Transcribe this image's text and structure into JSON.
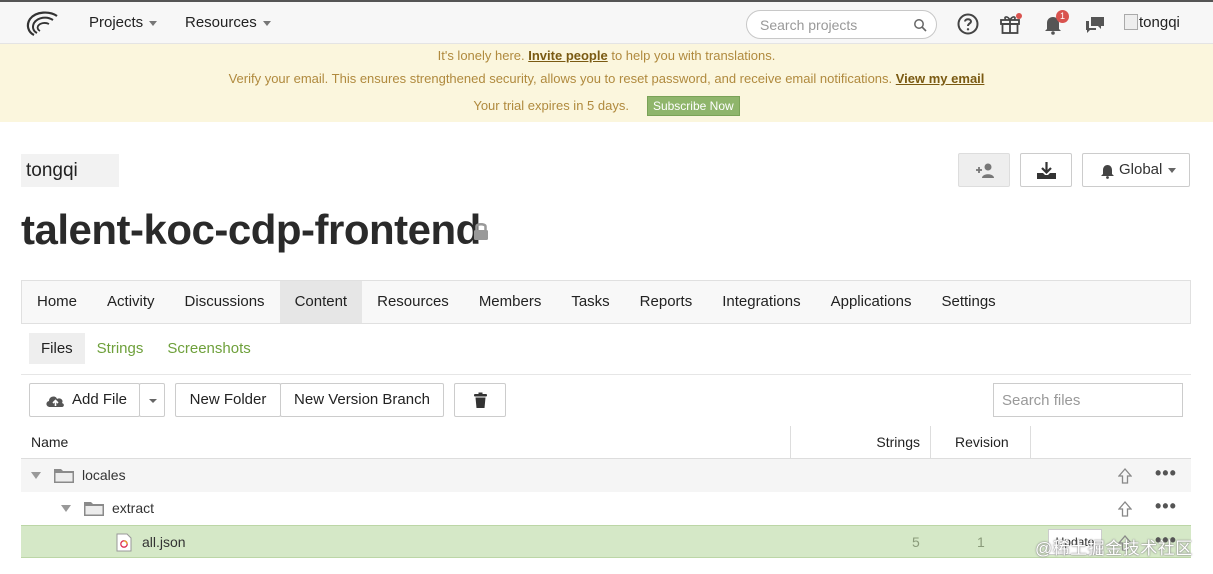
{
  "topbar": {
    "projects_label": "Projects",
    "resources_label": "Resources",
    "search_placeholder": "Search projects",
    "notification_count": "1",
    "user_alt": "tongqi"
  },
  "banner": {
    "line1_before": "It's lonely here. ",
    "line1_link": "Invite people",
    "line1_after": " to help you with translations.",
    "line2_before": "Verify your email. This ensures strengthened security, allows you to reset password, and receive email notifications. ",
    "line2_link": "View my email",
    "line3_text": "Your trial expires in 5 days.",
    "subscribe_label": "Subscribe Now"
  },
  "header": {
    "org_name": "tongqi",
    "project_title": "talent-koc-cdp-frontend",
    "global_label": "Global"
  },
  "tabs": [
    "Home",
    "Activity",
    "Discussions",
    "Content",
    "Resources",
    "Members",
    "Tasks",
    "Reports",
    "Integrations",
    "Applications",
    "Settings"
  ],
  "active_tab": "Content",
  "subtabs": [
    "Files",
    "Strings",
    "Screenshots"
  ],
  "toolbar": {
    "add_file_label": "Add File",
    "new_folder_label": "New Folder",
    "new_version_branch_label": "New Version Branch",
    "search_files_placeholder": "Search files"
  },
  "table": {
    "columns": {
      "name": "Name",
      "strings": "Strings",
      "revision": "Revision"
    },
    "rows": [
      {
        "name": "locales",
        "kind": "folder"
      },
      {
        "name": "extract",
        "kind": "folder"
      },
      {
        "name": "all.json",
        "kind": "file",
        "strings": "5",
        "revision": "1",
        "action_label": "Update"
      }
    ]
  },
  "watermark": "@稀土掘金技术社区",
  "colors": {
    "banner_bg": "#fbf6dd",
    "accent_green": "#6ea03b",
    "selected_row": "#d5e8c7"
  }
}
